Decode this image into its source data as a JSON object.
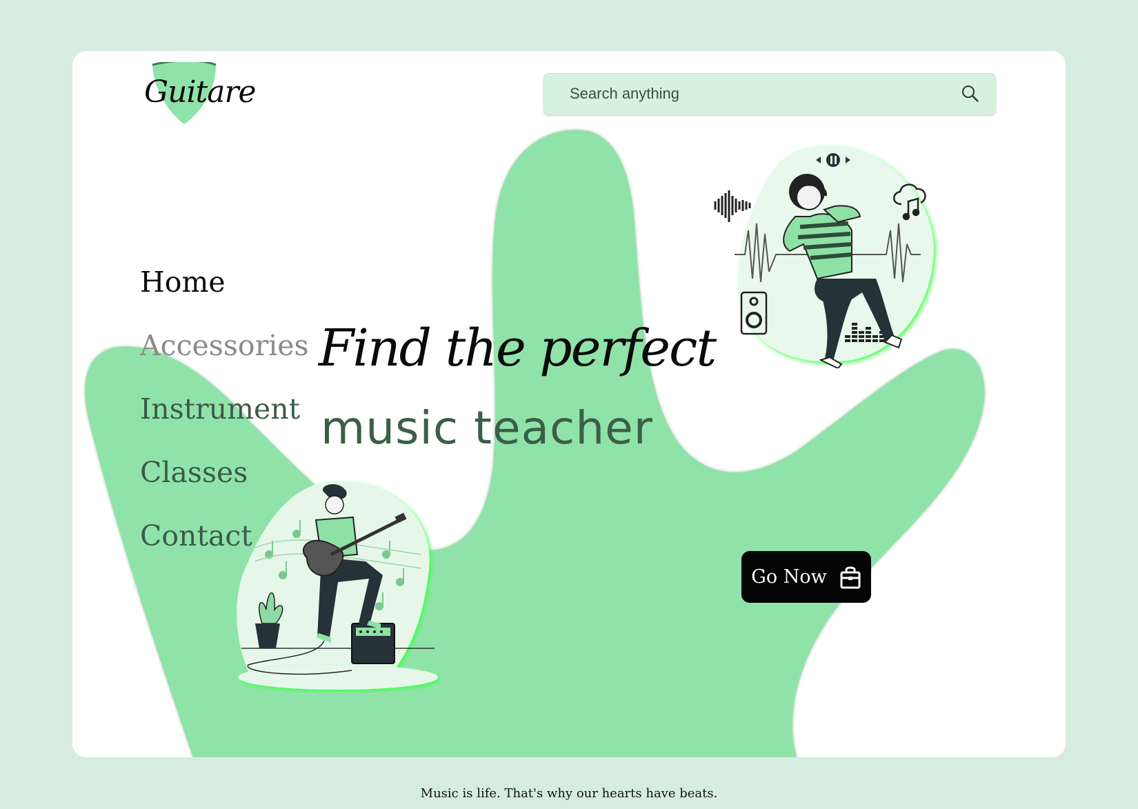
{
  "brand": {
    "name": "Guitare"
  },
  "search": {
    "placeholder": "Search anything"
  },
  "nav": {
    "items": [
      {
        "label": "Home"
      },
      {
        "label": "Accessories"
      },
      {
        "label": "Instrument"
      },
      {
        "label": "Classes"
      },
      {
        "label": "Contact"
      }
    ]
  },
  "hero": {
    "line1": "Find  the perfect",
    "line2": "music  teacher",
    "cta": "Go Now"
  },
  "footer": {
    "tagline": "Music is life. That's why our hearts have beats."
  },
  "colors": {
    "background": "#d7ece0",
    "card": "#ffffff",
    "accent_green": "#90e3a8",
    "search_bg": "#d4f2dc",
    "button": "#050505"
  },
  "icons": [
    "search-icon",
    "shopping-bag-icon",
    "guitar-pick-logo",
    "play-pause-icon",
    "speaker-icon",
    "cloud-music-icon",
    "sound-wave-icon",
    "equalizer-icon"
  ]
}
